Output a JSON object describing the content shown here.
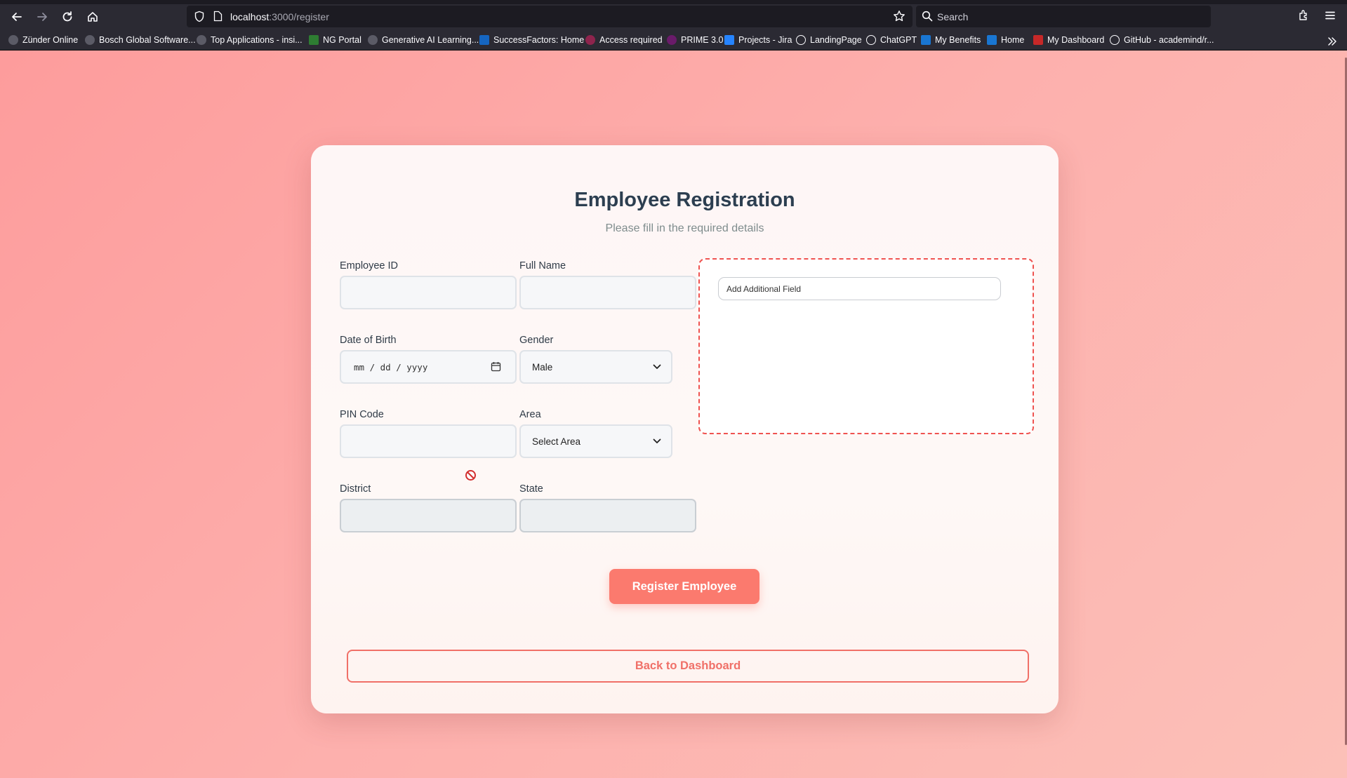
{
  "browser": {
    "url_host": "localhost",
    "url_path": ":3000/register",
    "search_placeholder": "Search",
    "bookmarks": [
      "Zünder Online",
      "Bosch Global Software...",
      "Top Applications - insi...",
      "NG Portal",
      "Generative AI Learning...",
      "SuccessFactors: Home",
      "Access required",
      "PRIME 3.0",
      "Projects - Jira",
      "LandingPage",
      "ChatGPT",
      "My Benefits",
      "Home",
      "My Dashboard",
      "GitHub - academind/r..."
    ]
  },
  "form": {
    "title": "Employee Registration",
    "subtitle": "Please fill in the required details",
    "employee_id_label": "Employee ID",
    "full_name_label": "Full Name",
    "dob_label": "Date of Birth",
    "dob_placeholder": "mm / dd / yyyy",
    "gender_label": "Gender",
    "gender_value": "Male",
    "pin_label": "PIN Code",
    "area_label": "Area",
    "area_value": "Select Area",
    "district_label": "District",
    "state_label": "State",
    "additional_field_text": "Add Additional Field",
    "register_button": "Register Employee",
    "back_button": "Back to Dashboard"
  },
  "colors": {
    "accent": "#fb7a6e",
    "dashed_border": "#ef5350",
    "blocked_icon": "#d32f2f"
  }
}
